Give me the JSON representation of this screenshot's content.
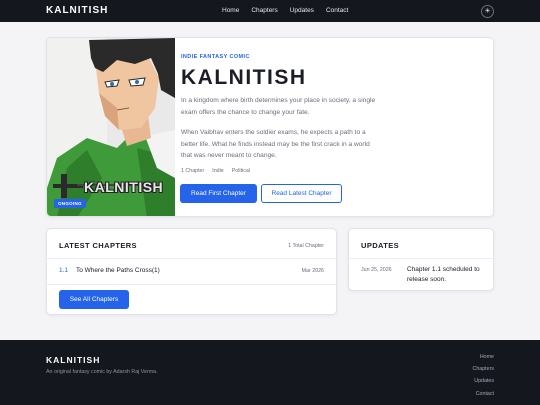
{
  "nav": {
    "logo": "KALNITISH",
    "links": [
      "Home",
      "Chapters",
      "Updates",
      "Contact"
    ],
    "theme_icon": "sun-icon"
  },
  "hero": {
    "cover_title": "KALNITISH",
    "badge": "ONGOING",
    "eyebrow": "INDIE FANTASY COMIC",
    "title": "KALNITISH",
    "paragraph1": "In a kingdom where birth determines your place in society, a single exam offers the chance to change your fate.",
    "paragraph2": "When Vaibhav enters the soldier exams, he expects a path to a better life. What he finds instead may be the first crack in a world that was never meant to change.",
    "tags": [
      "1 Chapter",
      "Indie",
      "Political"
    ],
    "read_first": "Read First Chapter",
    "read_latest": "Read Latest Chapter"
  },
  "chapters": {
    "heading": "LATEST CHAPTERS",
    "count": "1 Total Chapter",
    "items": [
      {
        "num": "1.1",
        "name": "To Where the Paths Cross(1)",
        "date": "Mar 2026"
      }
    ],
    "see_all": "See All Chapters"
  },
  "updates": {
    "heading": "UPDATES",
    "items": [
      {
        "date": "Jun 25, 2026",
        "text": "Chapter 1.1 scheduled to release soon."
      }
    ]
  },
  "footer": {
    "logo": "KALNITISH",
    "tagline": "An original fantasy comic by Adarsh Raj Verma.",
    "links": [
      "Home",
      "Chapters",
      "Updates",
      "Contact"
    ]
  },
  "colors": {
    "accent": "#2563eb",
    "dark": "#15171f"
  }
}
